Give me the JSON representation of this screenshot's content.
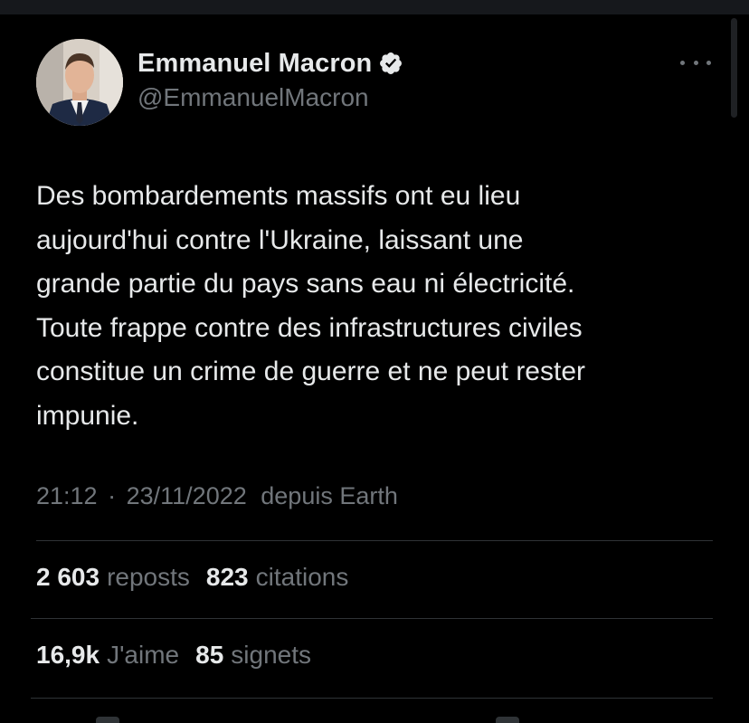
{
  "author": {
    "display_name": "Emmanuel Macron",
    "handle": "@EmmanuelMacron",
    "verified": true
  },
  "icons": {
    "verified": "verified-badge-icon",
    "more": "more-horizontal-icon"
  },
  "tweet": {
    "text": "Des bombardements massifs ont eu lieu\naujourd'hui contre l'Ukraine, laissant une\ngrande partie du pays sans eau ni électricité.\nToute frappe contre des infrastructures civiles\nconstitue un crime de guerre et ne peut rester\nimpunie.",
    "time": "21:12",
    "separator": "·",
    "date": "23/11/2022",
    "source": "depuis Earth"
  },
  "stats": {
    "reposts_count": "2 603",
    "reposts_label": "reposts",
    "quotes_count": "823",
    "quotes_label": "citations",
    "likes_count": "16,9k",
    "likes_label": "J'aime",
    "bookmarks_count": "85",
    "bookmarks_label": "signets"
  },
  "colors": {
    "background": "#000000",
    "text_primary": "#e7e9ea",
    "text_secondary": "#71767b",
    "divider": "#2f3336",
    "verified": "#e7e9ea"
  }
}
